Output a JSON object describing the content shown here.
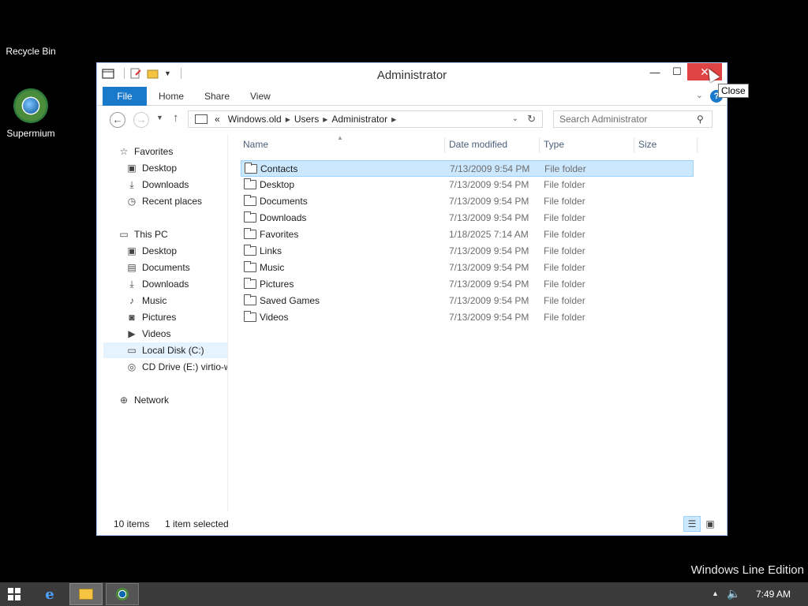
{
  "desktop": {
    "icons": [
      {
        "label": "Recycle Bin"
      },
      {
        "label": "Supermium"
      }
    ],
    "watermark": "Windows Line Edition"
  },
  "window": {
    "title": "Administrator",
    "close_tooltip": "Close",
    "ribbon": {
      "tabs": [
        "File",
        "Home",
        "Share",
        "View"
      ]
    },
    "address": {
      "prefix": "«",
      "crumbs": [
        "Windows.old",
        "Users",
        "Administrator"
      ]
    },
    "search": {
      "placeholder": "Search Administrator"
    },
    "nav": {
      "favorites": "Favorites",
      "favorites_items": [
        "Desktop",
        "Downloads",
        "Recent places"
      ],
      "this_pc": "This PC",
      "pc_items": [
        "Desktop",
        "Documents",
        "Downloads",
        "Music",
        "Pictures",
        "Videos",
        "Local Disk (C:)",
        "CD Drive (E:) virtio-w"
      ],
      "network": "Network"
    },
    "columns": {
      "name": "Name",
      "date": "Date modified",
      "type": "Type",
      "size": "Size"
    },
    "files": [
      {
        "name": "Contacts",
        "date": "7/13/2009 9:54 PM",
        "type": "File folder"
      },
      {
        "name": "Desktop",
        "date": "7/13/2009 9:54 PM",
        "type": "File folder"
      },
      {
        "name": "Documents",
        "date": "7/13/2009 9:54 PM",
        "type": "File folder"
      },
      {
        "name": "Downloads",
        "date": "7/13/2009 9:54 PM",
        "type": "File folder"
      },
      {
        "name": "Favorites",
        "date": "1/18/2025 7:14 AM",
        "type": "File folder"
      },
      {
        "name": "Links",
        "date": "7/13/2009 9:54 PM",
        "type": "File folder"
      },
      {
        "name": "Music",
        "date": "7/13/2009 9:54 PM",
        "type": "File folder"
      },
      {
        "name": "Pictures",
        "date": "7/13/2009 9:54 PM",
        "type": "File folder"
      },
      {
        "name": "Saved Games",
        "date": "7/13/2009 9:54 PM",
        "type": "File folder"
      },
      {
        "name": "Videos",
        "date": "7/13/2009 9:54 PM",
        "type": "File folder"
      }
    ],
    "status": {
      "count": "10 items",
      "selected": "1 item selected"
    }
  },
  "taskbar": {
    "clock": "7:49 AM"
  }
}
